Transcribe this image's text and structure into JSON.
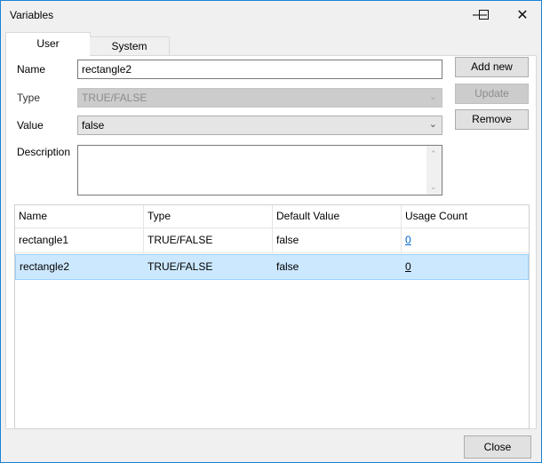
{
  "window": {
    "title": "Variables"
  },
  "tabs": [
    {
      "label": "User",
      "selected": true
    },
    {
      "label": "System",
      "selected": false
    }
  ],
  "form": {
    "name_label": "Name",
    "name_value": "rectangle2",
    "type_label": "Type",
    "type_value": "TRUE/FALSE",
    "value_label": "Value",
    "value_value": "false",
    "description_label": "Description",
    "description_value": ""
  },
  "buttons": {
    "add_new": "Add new",
    "update": "Update",
    "remove": "Remove",
    "close": "Close"
  },
  "table": {
    "columns": [
      "Name",
      "Type",
      "Default Value",
      "Usage Count"
    ],
    "rows": [
      {
        "name": "rectangle1",
        "type": "TRUE/FALSE",
        "default": "false",
        "usage": "0",
        "selected": false
      },
      {
        "name": "rectangle2",
        "type": "TRUE/FALSE",
        "default": "false",
        "usage": "0",
        "selected": true
      }
    ]
  },
  "colors": {
    "accent": "#1883d7",
    "selection": "#cce8ff"
  }
}
